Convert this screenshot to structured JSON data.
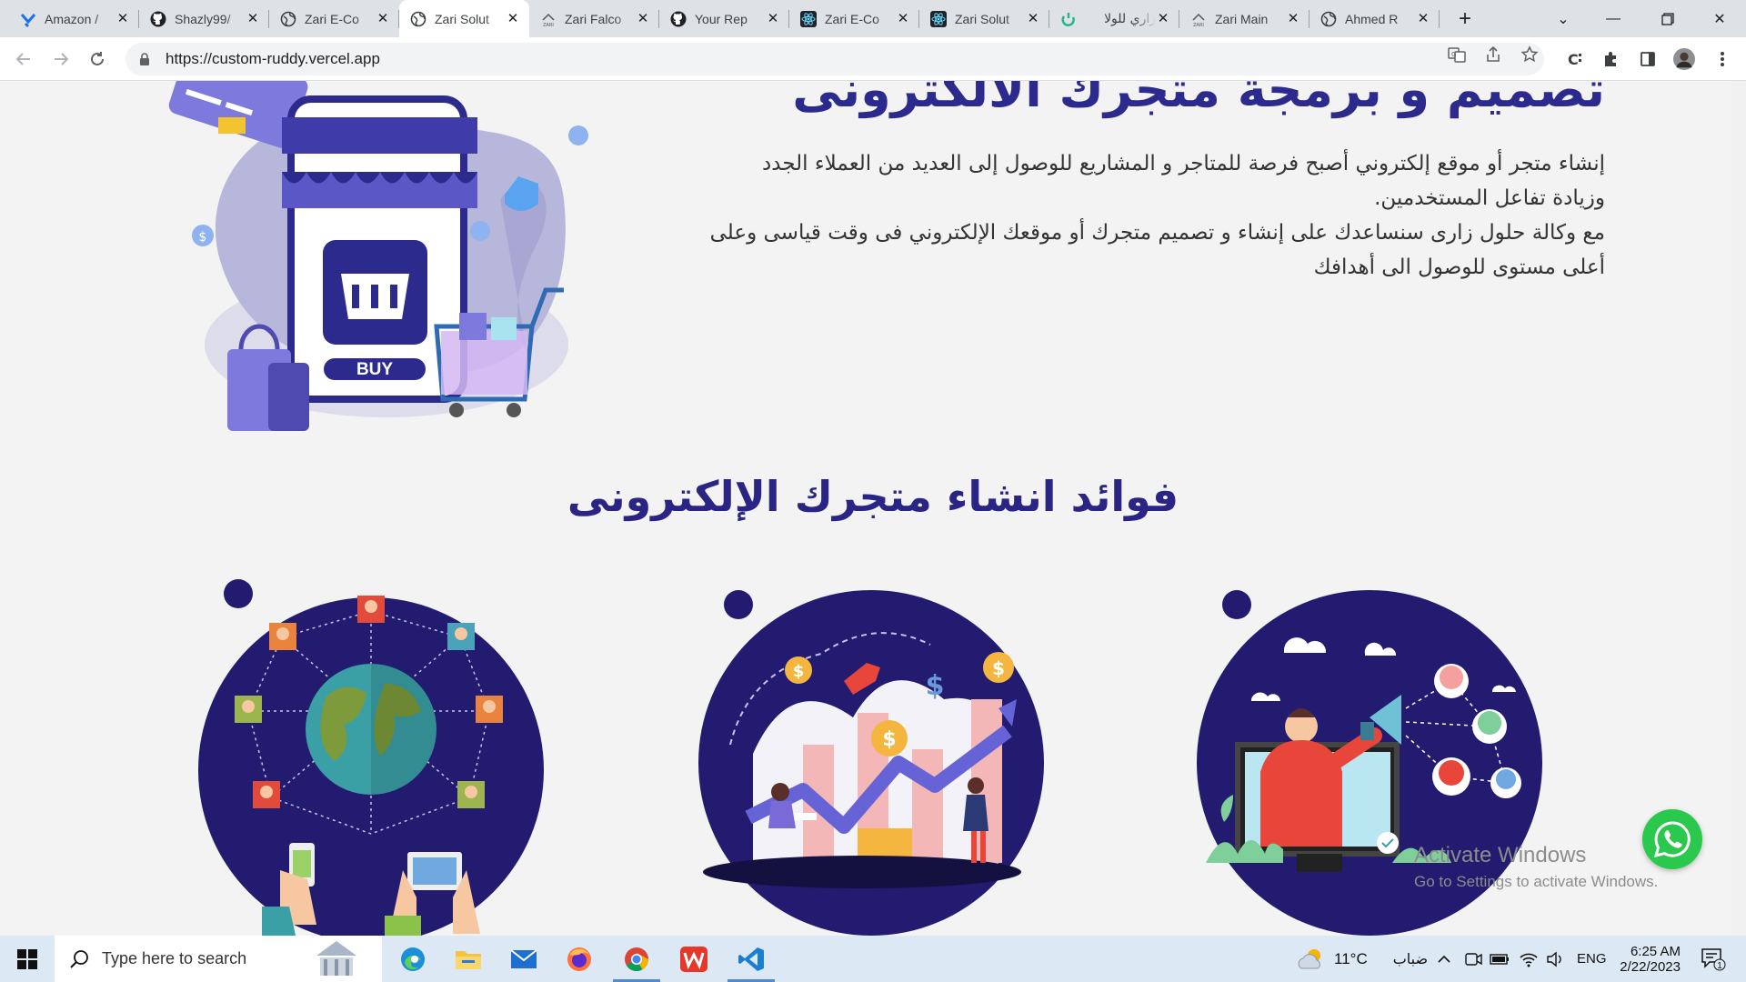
{
  "browser": {
    "tabs": [
      {
        "title": "Amazon /",
        "icon": "amazon-favicon",
        "active": false
      },
      {
        "title": "Shazly99/",
        "icon": "github-icon",
        "active": false
      },
      {
        "title": "Zari E-Co",
        "icon": "globe-icon",
        "active": false
      },
      {
        "title": "Zari Solut",
        "icon": "globe-icon",
        "active": true
      },
      {
        "title": "Zari Falco",
        "icon": "zari-favicon",
        "active": false
      },
      {
        "title": "Your Rep",
        "icon": "github-icon",
        "active": false
      },
      {
        "title": "Zari E-Co",
        "icon": "react-icon",
        "active": false
      },
      {
        "title": "Zari Solut",
        "icon": "react-icon",
        "active": false
      },
      {
        "title": "زاري للولا",
        "icon": "zari-green-favicon",
        "active": false
      },
      {
        "title": "Zari Main",
        "icon": "zari-favicon",
        "active": false
      },
      {
        "title": "Ahmed R",
        "icon": "globe-icon",
        "active": false
      }
    ],
    "url": "https://custom-ruddy.vercel.app"
  },
  "page": {
    "hero_title": "تصميم و برمجة متجرك الالكترونى",
    "hero_paragraph": [
      "إنشاء متجر أو موقع إلكتروني أصبح فرصة للمتاجر و المشاريع للوصول إلى العديد من العملاء الجدد",
      "وزيادة تفاعل المستخدمين.",
      "مع وكالة حلول زارى سنساعدك على إنشاء و تصميم متجرك أو موقعك الإلكتروني فى وقت قياسى وعلى",
      "أعلى مستوى للوصول الى أهدافك"
    ],
    "buy_label": "BUY",
    "section_title": "فوائد انشاء متجرك الإلكترونى",
    "benefits": [
      {
        "illustration": "global-network-illustration"
      },
      {
        "illustration": "growth-chart-illustration"
      },
      {
        "illustration": "marketing-megaphone-illustration"
      }
    ]
  },
  "overlay": {
    "activate_title": "Activate Windows",
    "activate_sub": "Go to Settings to activate Windows."
  },
  "taskbar": {
    "search_placeholder": "Type here to search",
    "weather_temp": "11°C",
    "weather_desc": "ضباب",
    "language": "ENG",
    "time": "6:25 AM",
    "date": "2/22/2023",
    "notification_count": "1"
  },
  "colors": {
    "brand_navy": "#2a2485",
    "circle_navy": "#221b70",
    "whatsapp_green": "#2ac94d"
  }
}
